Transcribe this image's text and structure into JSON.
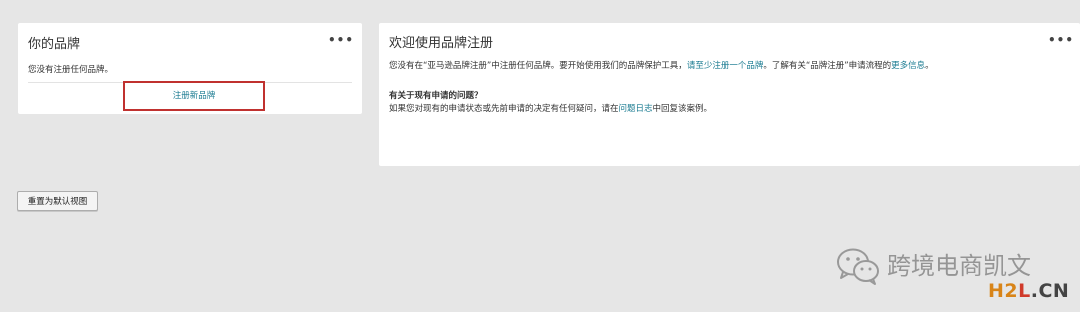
{
  "brand_card": {
    "title": "你的品牌",
    "more": "•••",
    "empty_text": "您没有注册任何品牌。",
    "register_link": "注册新品牌"
  },
  "welcome_card": {
    "title": "欢迎使用品牌注册",
    "more": "•••",
    "intro_before_link": "您没有在“亚马逊品牌注册”中注册任何品牌。要开始使用我们的品牌保护工具，",
    "register_link": "请至少注册一个品牌",
    "intro_middle": "。了解有关“品牌注册”申请流程的",
    "more_info_link": "更多信息",
    "intro_end": "。",
    "question_heading": "有关于现有申请的问题？",
    "question_before_link": "如果您对现有的申请状态或先前申请的决定有任何疑问，请在",
    "case_log_link": "问题日志",
    "question_after_link": "中回复该案例。"
  },
  "reset_button": "重置为默认视图",
  "watermark": {
    "text": "跨境电商凯文",
    "icon": "wechat-icon",
    "site_part1": "H2",
    "site_part2": "L",
    "site_part3": ".CN"
  },
  "colors": {
    "background": "#e6e6e6",
    "link": "#1a7b91",
    "highlight_border": "#c0312f",
    "logo_orange": "#d88418",
    "logo_red": "#d03a2a"
  }
}
